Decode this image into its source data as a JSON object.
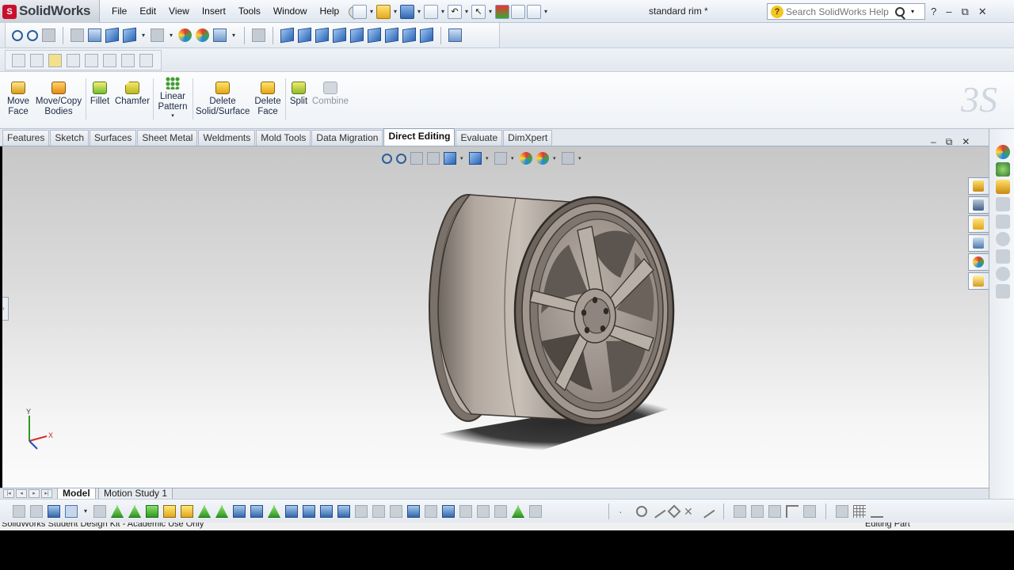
{
  "app": {
    "logo_badge": "S",
    "name": "SolidWorks"
  },
  "menu": {
    "items": [
      {
        "label": "File"
      },
      {
        "label": "Edit"
      },
      {
        "label": "View"
      },
      {
        "label": "Insert"
      },
      {
        "label": "Tools"
      },
      {
        "label": "Window"
      },
      {
        "label": "Help"
      }
    ]
  },
  "document": {
    "title": "standard rim *"
  },
  "search": {
    "help_glyph": "?",
    "placeholder": "Search SolidWorks Help"
  },
  "window_controls": {
    "help": "?",
    "minimize": "–",
    "restore": "⧉",
    "close": "✕"
  },
  "command_manager": {
    "commands": [
      {
        "label": "Move\nFace",
        "icon": "move-face-icon"
      },
      {
        "label": "Move/Copy\nBodies",
        "icon": "move-copy-bodies-icon"
      },
      {
        "label": "Fillet",
        "icon": "fillet-icon"
      },
      {
        "label": "Chamfer",
        "icon": "chamfer-icon"
      },
      {
        "label": "Linear\nPattern",
        "icon": "linear-pattern-icon"
      },
      {
        "label": "Delete\nSolid/Surface",
        "icon": "delete-solid-icon"
      },
      {
        "label": "Delete\nFace",
        "icon": "delete-face-icon"
      },
      {
        "label": "Split",
        "icon": "split-icon"
      },
      {
        "label": "Combine",
        "icon": "combine-icon"
      }
    ]
  },
  "tabs": [
    {
      "label": "Features"
    },
    {
      "label": "Sketch"
    },
    {
      "label": "Surfaces"
    },
    {
      "label": "Sheet Metal"
    },
    {
      "label": "Weldments"
    },
    {
      "label": "Mold Tools"
    },
    {
      "label": "Data Migration"
    },
    {
      "label": "Direct Editing",
      "active": true
    },
    {
      "label": "Evaluate"
    },
    {
      "label": "DimXpert"
    }
  ],
  "graphics_window": {
    "minimize": "–",
    "restore": "⧉",
    "close": "✕"
  },
  "triad": {
    "x": "X",
    "y": "Y"
  },
  "bottom_tabs": [
    {
      "label": "Model",
      "active": true
    },
    {
      "label": "Motion Study 1"
    }
  ],
  "status": {
    "left": "SolidWorks Student Design Kit - Academic Use Only",
    "right": "Editing Part"
  },
  "colors": {
    "active_tab": "#ffffff",
    "part_shade": "#a59b93",
    "shadow": "#2e2e2e"
  }
}
